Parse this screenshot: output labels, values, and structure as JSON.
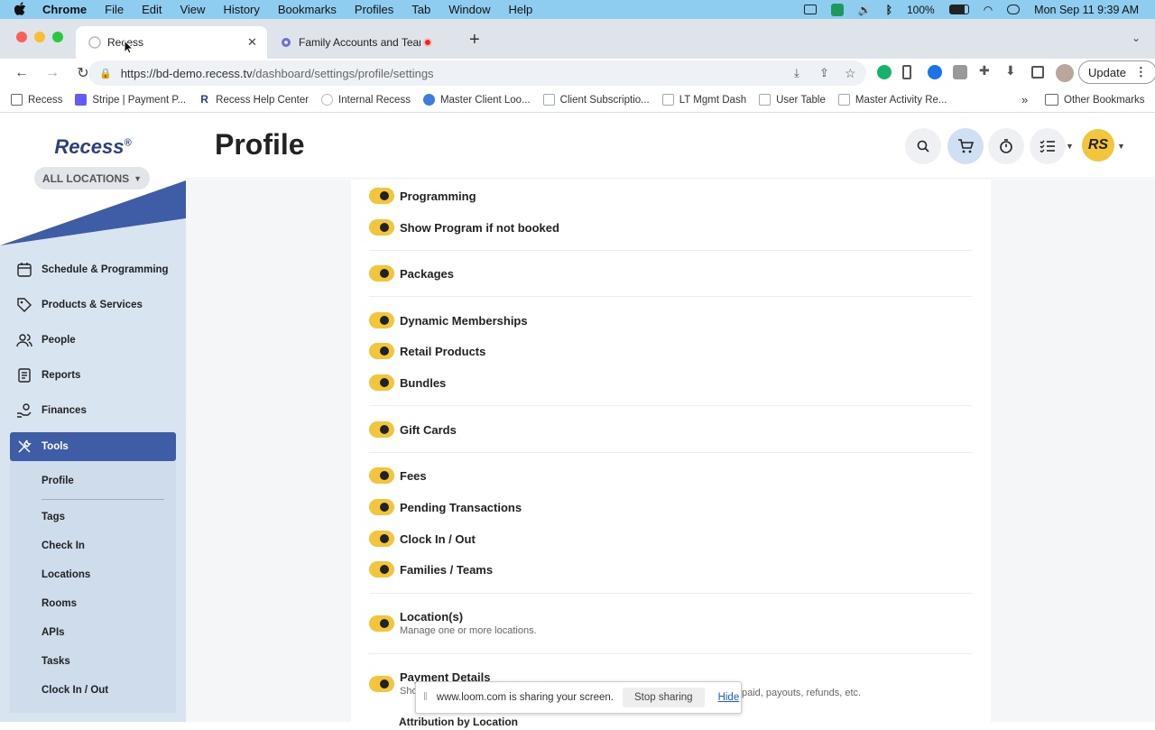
{
  "menubar": {
    "apple": "",
    "app": "Chrome",
    "items": [
      "File",
      "Edit",
      "View",
      "History",
      "Bookmarks",
      "Profiles",
      "Tab",
      "Window",
      "Help"
    ],
    "battery": "100%",
    "datetime": "Mon Sep 11  9:39 AM"
  },
  "tabs": [
    {
      "title": "Recess",
      "active": true
    },
    {
      "title": "Family Accounts and Team",
      "active": false
    }
  ],
  "browser": {
    "url_host": "https://bd-demo.recess.tv",
    "url_path": "/dashboard/settings/profile/settings",
    "update_label": "Update"
  },
  "bookmarks": [
    "Recess",
    "Stripe | Payment P...",
    "Recess Help Center",
    "Internal Recess",
    "Master Client Loo...",
    "Client Subscriptio...",
    "LT Mgmt Dash",
    "User Table",
    "Master Activity Re..."
  ],
  "bookmarks_more": "»",
  "bookmarks_other": "Other Bookmarks",
  "sidebar": {
    "logo": "Recess",
    "logo_mark": "®",
    "locations_label": "ALL LOCATIONS",
    "items": [
      "Schedule & Programming",
      "Products & Services",
      "People",
      "Reports",
      "Finances"
    ],
    "tools_label": "Tools",
    "tools_sub": [
      "Profile",
      "Tags",
      "Check In",
      "Locations",
      "Rooms",
      "APIs",
      "Tasks",
      "Clock In / Out"
    ]
  },
  "header": {
    "title": "Profile",
    "avatar": "RS"
  },
  "settings": [
    {
      "label": "Programming"
    },
    {
      "label": "Show Program if not booked"
    },
    {
      "label": "Packages"
    },
    {
      "label": "Dynamic Memberships"
    },
    {
      "label": "Retail Products"
    },
    {
      "label": "Bundles"
    },
    {
      "label": "Gift Cards"
    },
    {
      "label": "Fees"
    },
    {
      "label": "Pending Transactions"
    },
    {
      "label": "Clock In / Out"
    },
    {
      "label": "Families / Teams"
    },
    {
      "label": "Location(s)",
      "sub": "Manage one or more locations."
    },
    {
      "label": "Payment Details",
      "sub": "Sho"
    }
  ],
  "obscured": {
    "payment_tail": "paid, payouts, refunds, etc.",
    "next_heading": "Attribution by Location"
  },
  "loom": {
    "message": "www.loom.com is sharing your screen.",
    "stop": "Stop sharing",
    "hide": "Hide"
  },
  "colors": {
    "accent_blue": "#3f5ca6",
    "toggle_yellow": "#f2c53b",
    "menubar": "#8ecdf0"
  }
}
